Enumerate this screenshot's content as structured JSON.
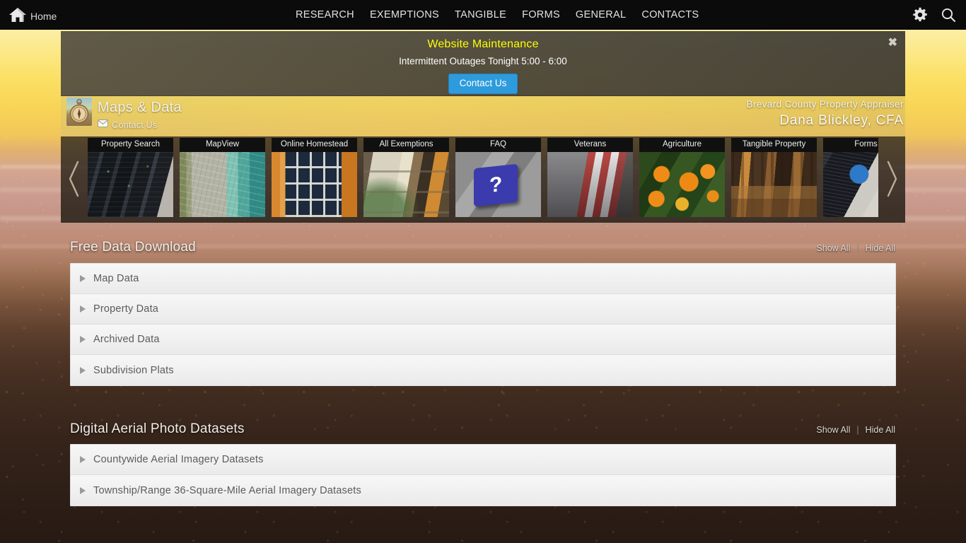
{
  "topnav": {
    "home_label": "Home",
    "home_icon": "home-icon",
    "menu": [
      {
        "label": "RESEARCH"
      },
      {
        "label": "EXEMPTIONS"
      },
      {
        "label": "TANGIBLE"
      },
      {
        "label": "FORMS"
      },
      {
        "label": "GENERAL"
      },
      {
        "label": "CONTACTS"
      }
    ],
    "gear_icon": "gear-icon",
    "search_icon": "search-icon"
  },
  "banner": {
    "title": "Website Maintenance",
    "subtitle": "Intermittent Outages Tonight 5:00 - 6:00",
    "button_label": "Contact Us",
    "close_label": "✖",
    "title_color": "#ffff00",
    "button_color": "#2e9bdc"
  },
  "site_header": {
    "title": "Maps & Data",
    "contact_label": "Contact Us",
    "compass_icon": "compass-icon",
    "envelope_icon": "envelope-icon",
    "agency": "Brevard County Property Appraiser",
    "officer": "Dana Blickley, CFA"
  },
  "carousel": {
    "prev_icon": "chevron-left-icon",
    "next_icon": "chevron-right-icon",
    "tiles": [
      {
        "label": "Property Search",
        "art": "art-server"
      },
      {
        "label": "MapView",
        "art": "art-map"
      },
      {
        "label": "Online Homestead",
        "art": "art-homestead"
      },
      {
        "label": "All Exemptions",
        "art": "art-exempt"
      },
      {
        "label": "FAQ",
        "art": "art-faq"
      },
      {
        "label": "Veterans",
        "art": "art-vet"
      },
      {
        "label": "Agriculture",
        "art": "art-ag"
      },
      {
        "label": "Tangible Property",
        "art": "art-tang"
      },
      {
        "label": "Forms",
        "art": "art-forms"
      }
    ]
  },
  "panels": [
    {
      "title": "Free Data Download",
      "show_all": "Show All",
      "separator": "|",
      "hide_all": "Hide All",
      "rows": [
        {
          "label": "Map Data"
        },
        {
          "label": "Property Data"
        },
        {
          "label": "Archived Data"
        },
        {
          "label": "Subdivision Plats"
        }
      ]
    },
    {
      "title": "Digital Aerial Photo Datasets",
      "show_all": "Show All",
      "separator": "|",
      "hide_all": "Hide All",
      "rows": [
        {
          "label": "Countywide Aerial Imagery Datasets"
        },
        {
          "label": "Township/Range 36-Square-Mile Aerial Imagery Datasets"
        }
      ]
    }
  ]
}
